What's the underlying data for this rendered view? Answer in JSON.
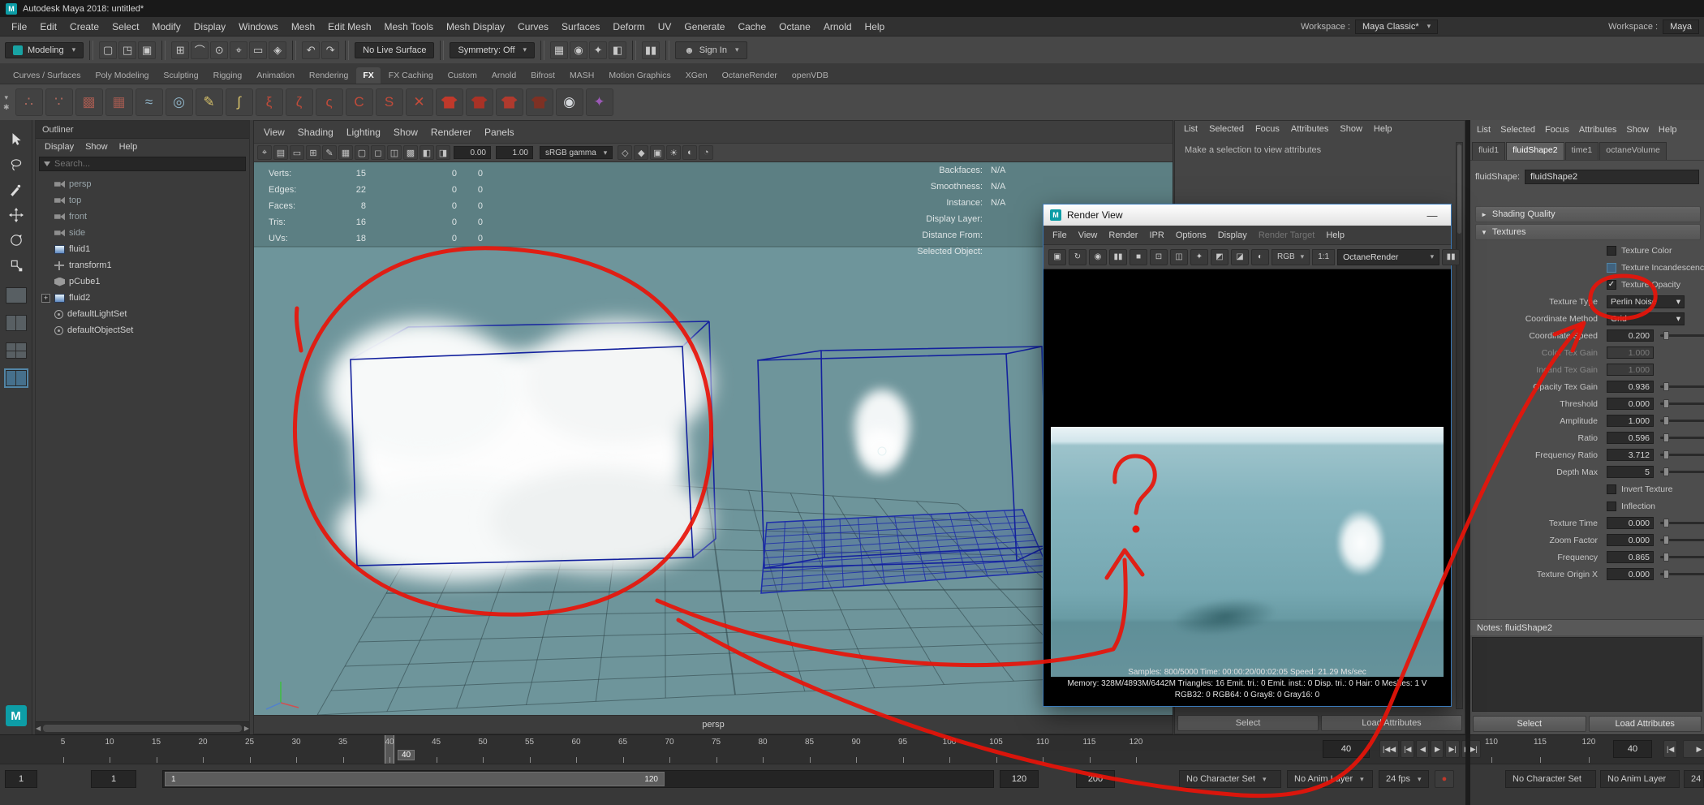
{
  "colors": {
    "annotation_red": "#e81309",
    "viewport_teal": "#6e959b",
    "accent_blue": "#5285a6",
    "wireframe_blue": "#14229e"
  },
  "titlebar": {
    "title": "Autodesk Maya 2018: untitled*"
  },
  "menubar": {
    "items": [
      "File",
      "Edit",
      "Create",
      "Select",
      "Modify",
      "Display",
      "Windows",
      "Mesh",
      "Edit Mesh",
      "Mesh Tools",
      "Mesh Display",
      "Curves",
      "Surfaces",
      "Deform",
      "UV",
      "Generate",
      "Cache",
      "Octane",
      "Arnold",
      "Help"
    ],
    "workspace_label": "Workspace :",
    "workspace_value": "Maya Classic*",
    "workspace2_label": "Workspace :",
    "workspace2_value": "Maya"
  },
  "statusline": {
    "mode_selector": "Modeling",
    "live_surface": "No Live Surface",
    "symmetry": "Symmetry: Off",
    "sign_in": "Sign In",
    "pause_label": "▮▮",
    "file_icons": [
      {
        "name": "new-scene-icon",
        "glyph": "▢"
      },
      {
        "name": "open-scene-icon",
        "glyph": "◳"
      },
      {
        "name": "save-scene-icon",
        "glyph": "▣"
      }
    ],
    "snap_icons": [
      {
        "name": "snap-to-grid-icon",
        "glyph": "⊞"
      },
      {
        "name": "snap-to-curve-icon",
        "glyph": "⌒"
      },
      {
        "name": "snap-to-point-icon",
        "glyph": "⊙"
      },
      {
        "name": "snap-to-projected-center-icon",
        "glyph": "⌖"
      },
      {
        "name": "snap-to-view-plane-icon",
        "glyph": "▭"
      },
      {
        "name": "make-object-live-icon",
        "glyph": "◈"
      }
    ],
    "history_icons": [
      {
        "name": "construction-history-icon",
        "glyph": "↶"
      },
      {
        "name": "redo-icon",
        "glyph": "↷"
      }
    ],
    "render_icons": [
      {
        "name": "render-current-frame-icon",
        "glyph": "▦"
      },
      {
        "name": "ipr-render-icon",
        "glyph": "◉"
      },
      {
        "name": "render-settings-icon",
        "glyph": "✦"
      },
      {
        "name": "launch-render-view-icon",
        "glyph": "◧"
      }
    ]
  },
  "shelf": {
    "tabs": [
      "Curves / Surfaces",
      "Poly Modeling",
      "Sculpting",
      "Rigging",
      "Animation",
      "Rendering",
      "FX",
      "FX Caching",
      "Custom",
      "Arnold",
      "Bifrost",
      "MASH",
      "Motion Graphics",
      "XGen",
      "OctaneRender",
      "openVDB"
    ],
    "active_tab": "FX",
    "icons": [
      {
        "name": "nparticles-icon",
        "kind": "glyph",
        "glyph": "∴",
        "color": "#b06a5e"
      },
      {
        "name": "emit-from-object-icon",
        "kind": "glyph",
        "glyph": "∵",
        "color": "#b06a5e"
      },
      {
        "name": "fluid-container-3d-icon",
        "kind": "glyph",
        "glyph": "▩",
        "color": "#a05a50"
      },
      {
        "name": "fluid-container-2d-icon",
        "kind": "glyph",
        "glyph": "▦",
        "color": "#a05a50"
      },
      {
        "name": "ocean-icon",
        "kind": "glyph",
        "glyph": "≈",
        "color": "#8fb4c8"
      },
      {
        "name": "pond-icon",
        "kind": "glyph",
        "glyph": "◎",
        "color": "#8fb4c8"
      },
      {
        "name": "paint-effects-icon",
        "kind": "glyph",
        "glyph": "✎",
        "color": "#d8c26a"
      },
      {
        "name": "curve-utilities-icon",
        "kind": "glyph",
        "glyph": "∫",
        "color": "#d8c26a"
      },
      {
        "name": "nhair-create-icon",
        "kind": "glyph",
        "glyph": "ξ",
        "color": "#c24b3a"
      },
      {
        "name": "nhair-paint-icon",
        "kind": "glyph",
        "glyph": "ζ",
        "color": "#c24b3a"
      },
      {
        "name": "dynamic-curve-icon",
        "kind": "glyph",
        "glyph": "ς",
        "color": "#c24b3a"
      },
      {
        "name": "nconstraint-component-icon",
        "kind": "glyph",
        "glyph": "C",
        "color": "#c24b3a"
      },
      {
        "name": "nconstraint-slide-icon",
        "kind": "glyph",
        "glyph": "S",
        "color": "#c24b3a"
      },
      {
        "name": "nconstraint-weld-icon",
        "kind": "glyph",
        "glyph": "✕",
        "color": "#c24b3a"
      },
      {
        "name": "ncloth-create-icon",
        "kind": "shirt",
        "color": "#c0392b"
      },
      {
        "name": "ncloth-passive-collider-icon",
        "kind": "shirt",
        "color": "#a93226"
      },
      {
        "name": "ncloth-input-attract-icon",
        "kind": "shirt",
        "color": "#b03a2e"
      },
      {
        "name": "ncloth-rest-shape-icon",
        "kind": "shirt",
        "color": "#7e3124"
      },
      {
        "name": "collision-sphere-icon",
        "kind": "glyph",
        "glyph": "◉",
        "color": "#d5d8dc"
      },
      {
        "name": "volume-sculpt-icon",
        "kind": "glyph",
        "glyph": "✦",
        "color": "#9b59b6"
      }
    ]
  },
  "toolbox": {
    "tools": [
      "select-tool",
      "lasso-select-tool",
      "paint-select-tool",
      "move-tool",
      "rotate-tool",
      "scale-tool"
    ],
    "layouts": [
      "layout-single-perspective",
      "layout-four-view",
      "layout-persp-outliner",
      "layout-two-pane"
    ]
  },
  "outliner": {
    "title": "Outliner",
    "menus": [
      "Display",
      "Show",
      "Help"
    ],
    "search_placeholder": "Search...",
    "items": [
      {
        "label": "persp",
        "icon": "camera",
        "dim": true
      },
      {
        "label": "top",
        "icon": "camera",
        "dim": true
      },
      {
        "label": "front",
        "icon": "camera",
        "dim": true
      },
      {
        "label": "side",
        "icon": "camera",
        "dim": true
      },
      {
        "label": "fluid1",
        "icon": "fluid"
      },
      {
        "label": "transform1",
        "icon": "transform"
      },
      {
        "label": "pCube1",
        "icon": "cube"
      },
      {
        "label": "fluid2",
        "icon": "fluid",
        "expandable": true
      },
      {
        "label": "defaultLightSet",
        "icon": "set"
      },
      {
        "label": "defaultObjectSet",
        "icon": "set"
      }
    ]
  },
  "viewport": {
    "menus": [
      "View",
      "Shading",
      "Lighting",
      "Show",
      "Renderer",
      "Panels"
    ],
    "toolbar": {
      "exposure_value": "0.00",
      "gamma_value": "1.00",
      "color_space": "sRGB gamma",
      "icons_left": [
        {
          "name": "camera-attributes-icon",
          "glyph": "⌖"
        },
        {
          "name": "bookmarks-icon",
          "glyph": "▤"
        },
        {
          "name": "image-plane-icon",
          "glyph": "▭"
        },
        {
          "name": "two-d-pan-zoom-icon",
          "glyph": "⊞"
        },
        {
          "name": "grease-pencil-icon",
          "glyph": "✎"
        },
        {
          "name": "grid-toggle-icon",
          "glyph": "▦"
        },
        {
          "name": "film-gate-icon",
          "glyph": "▢"
        },
        {
          "name": "resolution-gate-icon",
          "glyph": "◻"
        },
        {
          "name": "gate-mask-icon",
          "glyph": "◫"
        },
        {
          "name": "field-chart-icon",
          "glyph": "▩"
        },
        {
          "name": "safe-action-icon",
          "glyph": "◧"
        },
        {
          "name": "safe-title-icon",
          "glyph": "◨"
        }
      ],
      "icons_right": [
        {
          "name": "wireframe-mode-icon",
          "glyph": "◇"
        },
        {
          "name": "shaded-mode-icon",
          "glyph": "◆"
        },
        {
          "name": "textured-mode-icon",
          "glyph": "▣"
        },
        {
          "name": "lights-toggle-icon",
          "glyph": "☀"
        },
        {
          "name": "shadows-toggle-icon",
          "glyph": "◐"
        },
        {
          "name": "xray-mode-icon",
          "glyph": "◔"
        }
      ]
    },
    "hud": {
      "poly_rows": [
        {
          "label": "Verts:",
          "total": "15",
          "selected": "0",
          "third": "0"
        },
        {
          "label": "Edges:",
          "total": "22",
          "selected": "0",
          "third": "0"
        },
        {
          "label": "Faces:",
          "total": "8",
          "selected": "0",
          "third": "0"
        },
        {
          "label": "Tris:",
          "total": "16",
          "selected": "0",
          "third": "0"
        },
        {
          "label": "UVs:",
          "total": "18",
          "selected": "0",
          "third": "0"
        }
      ],
      "info_rows": [
        {
          "label": "Backfaces:",
          "value": "N/A"
        },
        {
          "label": "Smoothness:",
          "value": "N/A"
        },
        {
          "label": "Instance:",
          "value": "N/A"
        },
        {
          "label": "Display Layer:",
          "value": ""
        },
        {
          "label": "Distance From:",
          "value": ""
        },
        {
          "label": "Selected Object:",
          "value": ""
        }
      ]
    },
    "camera_label": "persp"
  },
  "render_view": {
    "title": "Render View",
    "minimize_label": "—",
    "menus": [
      "File",
      "View",
      "Render",
      "IPR",
      "Options",
      "Display",
      "Render Target",
      "Help"
    ],
    "disabled_menu": "Render Target",
    "toolbar_icons": [
      {
        "name": "render-icon",
        "glyph": "▣"
      },
      {
        "name": "redo-previous-render-icon",
        "glyph": "↻"
      },
      {
        "name": "ipr-render-icon",
        "glyph": "◉"
      },
      {
        "name": "pause-ipr-icon",
        "glyph": "▮▮"
      },
      {
        "name": "stop-ipr-icon",
        "glyph": "■"
      },
      {
        "name": "region-render-icon",
        "glyph": "⊡"
      },
      {
        "name": "snapshot-icon",
        "glyph": "◫"
      },
      {
        "name": "render-settings-icon",
        "glyph": "✦"
      },
      {
        "name": "display-rgb-channels-icon",
        "glyph": "◩"
      },
      {
        "name": "display-alpha-channel-icon",
        "glyph": "◪"
      },
      {
        "name": "color-management-icon",
        "glyph": "◐"
      }
    ],
    "channel_label": "RGB",
    "zoom_label": "1:1",
    "renderer": "OctaneRender",
    "pause_label": "▮▮",
    "stats": [
      "Samples: 800/5000  Time: 00:00:20/00:02:05  Speed: 21.29 Ms/sec",
      "Memory: 328M/4893M/6442M  Triangles: 16  Emit. tri.: 0  Emit. inst.: 0  Disp. tri.: 0  Hair: 0  Meshes: 1 V",
      "RGB32: 0 RGB64: 0 Gray8: 0 Gray16: 0"
    ]
  },
  "middle_panel": {
    "menus": [
      "List",
      "Selected",
      "Focus",
      "Attributes",
      "Show",
      "Help"
    ],
    "message": "Make a selection to view attributes",
    "buttons": [
      "Select",
      "Load Attributes"
    ]
  },
  "attribute_editor": {
    "menus": [
      "List",
      "Selected",
      "Focus",
      "Attributes",
      "Show",
      "Help"
    ],
    "tabs": [
      "fluid1",
      "fluidShape2",
      "time1",
      "octaneVolume"
    ],
    "active_tab": "fluidShape2",
    "node_type_label": "fluidShape:",
    "node_name": "fluidShape2",
    "sections": [
      {
        "label": "Shading Quality",
        "expanded": false
      },
      {
        "label": "Textures",
        "expanded": true
      }
    ],
    "rows": [
      {
        "type": "checkbox",
        "label": "Texture Color",
        "checked": false
      },
      {
        "type": "checkbox",
        "label": "Texture Incandescence",
        "checked": false,
        "highlight": true
      },
      {
        "type": "checkbox",
        "label": "Texture Opacity",
        "checked": true
      },
      {
        "type": "dropdown",
        "label": "Texture Type",
        "value": "Perlin Noise"
      },
      {
        "type": "dropdown",
        "label": "Coordinate Method",
        "value": "Grid"
      },
      {
        "type": "slider",
        "label": "Coordinate Speed",
        "value": "0.200"
      },
      {
        "type": "slider",
        "label": "Color Tex Gain",
        "value": "1.000",
        "disabled": true
      },
      {
        "type": "slider",
        "label": "Incand Tex Gain",
        "value": "1.000",
        "disabled": true
      },
      {
        "type": "slider",
        "label": "Opacity Tex Gain",
        "value": "0.936"
      },
      {
        "type": "slider",
        "label": "Threshold",
        "value": "0.000"
      },
      {
        "type": "slider",
        "label": "Amplitude",
        "value": "1.000"
      },
      {
        "type": "slider",
        "label": "Ratio",
        "value": "0.596"
      },
      {
        "type": "slider",
        "label": "Frequency Ratio",
        "value": "3.712"
      },
      {
        "type": "slider",
        "label": "Depth Max",
        "value": "5"
      },
      {
        "type": "checkbox",
        "label": "Invert Texture",
        "checked": false
      },
      {
        "type": "checkbox",
        "label": "Inflection",
        "checked": false
      },
      {
        "type": "slider",
        "label": "Texture Time",
        "value": "0.000"
      },
      {
        "type": "slider",
        "label": "Zoom Factor",
        "value": "0.000"
      },
      {
        "type": "slider",
        "label": "Frequency",
        "value": "0.865"
      },
      {
        "type": "slider",
        "label": "Texture Origin X",
        "value": "0.000"
      }
    ],
    "notes_label": "Notes: fluidShape2",
    "buttons": [
      "Select",
      "Load Attributes"
    ]
  },
  "timeline": {
    "tick_labels": [
      "5",
      "10",
      "15",
      "20",
      "25",
      "30",
      "35",
      "40",
      "45",
      "50",
      "55",
      "60",
      "65",
      "70",
      "75",
      "80",
      "85",
      "90",
      "95",
      "100",
      "105",
      "110",
      "115",
      "120"
    ],
    "current_frame": "40",
    "frame_field": "40",
    "playback_buttons": [
      {
        "name": "go-to-start-button",
        "glyph": "|◀◀"
      },
      {
        "name": "step-back-frame-button",
        "glyph": "|◀"
      },
      {
        "name": "play-backwards-button",
        "glyph": "◀"
      },
      {
        "name": "play-forwards-button",
        "glyph": "▶"
      },
      {
        "name": "step-forward-frame-button",
        "glyph": "▶|"
      },
      {
        "name": "go-to-end-button",
        "glyph": "▶▶|"
      }
    ]
  },
  "timeline2": {
    "tick_labels": [
      "110",
      "115",
      "120"
    ],
    "frame_field": "40"
  },
  "range_slider": {
    "animation_start": "1",
    "playback_start": "1",
    "handle_start_label": "1",
    "handle_end_label": "120",
    "playback_end": "120",
    "animation_end": "200",
    "character_set": "No Character Set",
    "anim_layer": "No Anim Layer",
    "fps": "24 fps"
  },
  "range_slider2": {
    "character_set": "No Character Set",
    "anim_layer": "No Anim Layer",
    "fps": "24"
  }
}
